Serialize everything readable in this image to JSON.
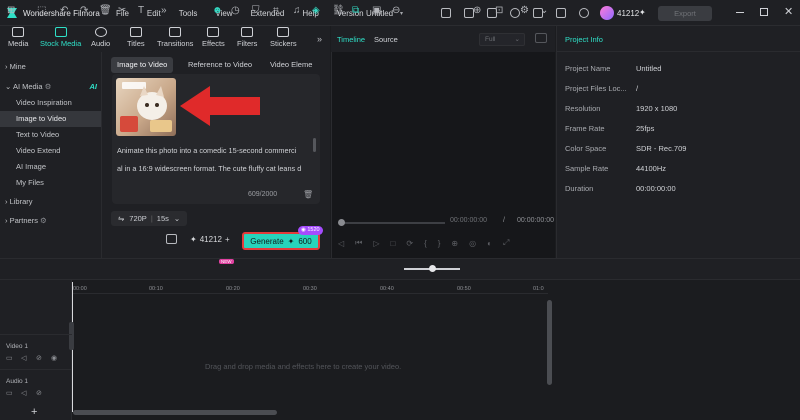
{
  "titlebar": {
    "app_name": "Wondershare Filmora",
    "menu": [
      "File",
      "Edit",
      "Tools",
      "View",
      "Extended",
      "Help",
      "Version"
    ],
    "project_title": "Untitled",
    "credits": "41212",
    "export_label": "Export"
  },
  "media_tabs": [
    {
      "label": "Media",
      "icon": "media-icon"
    },
    {
      "label": "Stock Media",
      "icon": "stock-media-icon"
    },
    {
      "label": "Audio",
      "icon": "audio-icon"
    },
    {
      "label": "Titles",
      "icon": "titles-icon"
    },
    {
      "label": "Transitions",
      "icon": "transitions-icon"
    },
    {
      "label": "Effects",
      "icon": "effects-icon"
    },
    {
      "label": "Filters",
      "icon": "filters-icon"
    },
    {
      "label": "Stickers",
      "icon": "stickers-icon"
    }
  ],
  "sidebar": {
    "mine": "Mine",
    "ai_media": "AI Media",
    "ai_badge": "AI",
    "items": [
      "Video Inspiration",
      "Image to Video",
      "Text to Video",
      "Video Extend",
      "AI Image",
      "My Files"
    ],
    "library": "Library",
    "partners": "Partners"
  },
  "content_tabs": [
    "Image to Video",
    "Reference to Video",
    "Video Eleme"
  ],
  "prompt": {
    "line1": "Animate this photo into a comedic 15-second commerci",
    "line2": "al in a 16:9 widescreen format. The cute fluffy cat leans d",
    "counter": "609/2000"
  },
  "options": {
    "resolution": "720P",
    "duration": "15s"
  },
  "generate": {
    "credits": "41212",
    "label": "Generate",
    "cost": "600",
    "badge": "1520"
  },
  "preview": {
    "tab_timeline": "Timeline",
    "tab_source": "Source",
    "quality": "Full",
    "timecode_current": "00:00:00:00",
    "timecode_sep": "/",
    "timecode_total": "00:00:00:00"
  },
  "project_info": {
    "title": "Project Info",
    "rows": [
      {
        "label": "Project Name",
        "value": "Untitled"
      },
      {
        "label": "Project Files Loc...",
        "value": "/"
      },
      {
        "label": "Resolution",
        "value": "1920 x 1080"
      },
      {
        "label": "Frame Rate",
        "value": "25fps"
      },
      {
        "label": "Color Space",
        "value": "SDR - Rec.709"
      },
      {
        "label": "Sample Rate",
        "value": "44100Hz"
      },
      {
        "label": "Duration",
        "value": "00:00:00:00"
      }
    ]
  },
  "timeline": {
    "ticks": [
      "00:00",
      "00:10",
      "00:20",
      "00:30",
      "00:40",
      "00:50",
      "01:0"
    ],
    "video_track": "Video 1",
    "audio_track": "Audio 1",
    "drop_message": "Drag and drop media and effects here to create your video.",
    "add_label": "+",
    "tool_badge": "NEW"
  },
  "colors": {
    "accent": "#27d3bb",
    "highlight": "#e23b3b",
    "badge": "#a54cff"
  }
}
